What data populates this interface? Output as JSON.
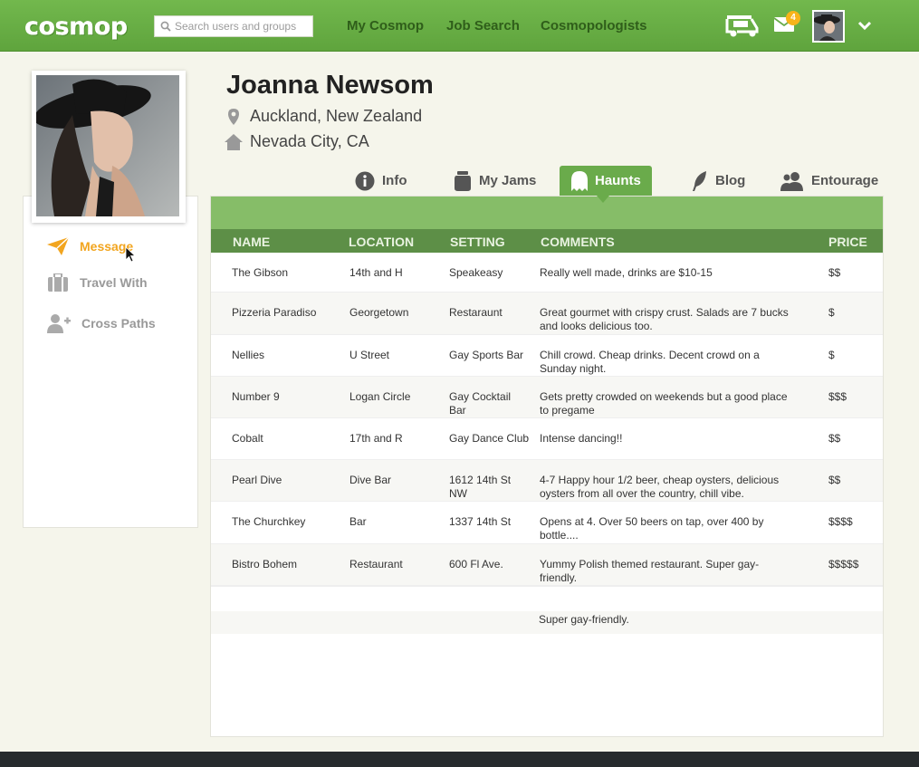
{
  "header": {
    "logo": "cosmop",
    "search_placeholder": "Search users and groups",
    "nav": [
      "My Cosmop",
      "Job Search",
      "Cosmopologists"
    ],
    "mail_badge": "4",
    "icons": [
      "tuk-tuk-icon",
      "mail-icon",
      "chevron-down-icon"
    ]
  },
  "profile": {
    "name": "Joanna Newsom",
    "current_location": "Auckland, New Zealand",
    "hometown": "Nevada City, CA",
    "actions": [
      {
        "label": "Message",
        "icon": "send-icon",
        "color": "#f2a51f"
      },
      {
        "label": "Travel With",
        "icon": "suitcase-icon"
      },
      {
        "label": "Cross Paths",
        "icon": "add-user-icon"
      }
    ]
  },
  "tabs": [
    {
      "label": "Info",
      "icon": "info-icon"
    },
    {
      "label": "My Jams",
      "icon": "jar-icon"
    },
    {
      "label": "Haunts",
      "icon": "ghost-icon",
      "active": true
    },
    {
      "label": "Blog",
      "icon": "feather-icon"
    },
    {
      "label": "Entourage",
      "icon": "group-icon"
    }
  ],
  "table": {
    "headers": [
      "NAME",
      "LOCATION",
      "SETTING",
      "COMMENTS",
      "PRICE"
    ],
    "rows": [
      {
        "name": "The Gibson",
        "location": "14th and H",
        "setting": "Speakeasy",
        "comments": "Really well made, drinks are $10-15",
        "price": "$$"
      },
      {
        "name": "Pizzeria Paradiso",
        "location": "Georgetown",
        "setting": "Restaraunt",
        "comments": "Great gourmet with crispy crust. Salads are 7 bucks and looks delicious too.",
        "price": "$"
      },
      {
        "name": "Nellies",
        "location": "U Street",
        "setting": "Gay Sports Bar",
        "comments": "Chill crowd. Cheap drinks. Decent crowd on a Sunday night.",
        "price": "$"
      },
      {
        "name": "Number 9",
        "location": "Logan Circle",
        "setting": "Gay Cocktail Bar",
        "comments": "Gets pretty crowded on weekends but a good place to pregame",
        "price": "$$$"
      },
      {
        "name": "Cobalt",
        "location": "17th and R",
        "setting": "Gay Dance Club",
        "comments": "Intense dancing!!",
        "price": "$$"
      },
      {
        "name": "Pearl Dive",
        "location": "Dive Bar",
        "setting": "1612 14th St NW",
        "comments": "4-7 Happy hour 1/2 beer, cheap oysters, delicious oysters from all over the country, chill vibe.",
        "price": "$$"
      },
      {
        "name": "The Churchkey",
        "location": "Bar",
        "setting": "1337 14th St",
        "comments": "Opens at 4. Over 50 beers on tap, over 400 by bottle....",
        "price": "$$$$"
      },
      {
        "name": "Bistro Bohem",
        "location": "Restaurant",
        "setting": "600 Fl Ave.",
        "comments": "Yummy Polish themed restaurant. Super gay-friendly.",
        "price": "$$$$$"
      }
    ],
    "ghost_text": "Super gay-friendly."
  },
  "colors": {
    "brand_green": "#6aab4b",
    "header_green": "#5d8f47",
    "accent_orange": "#f2a51f"
  }
}
